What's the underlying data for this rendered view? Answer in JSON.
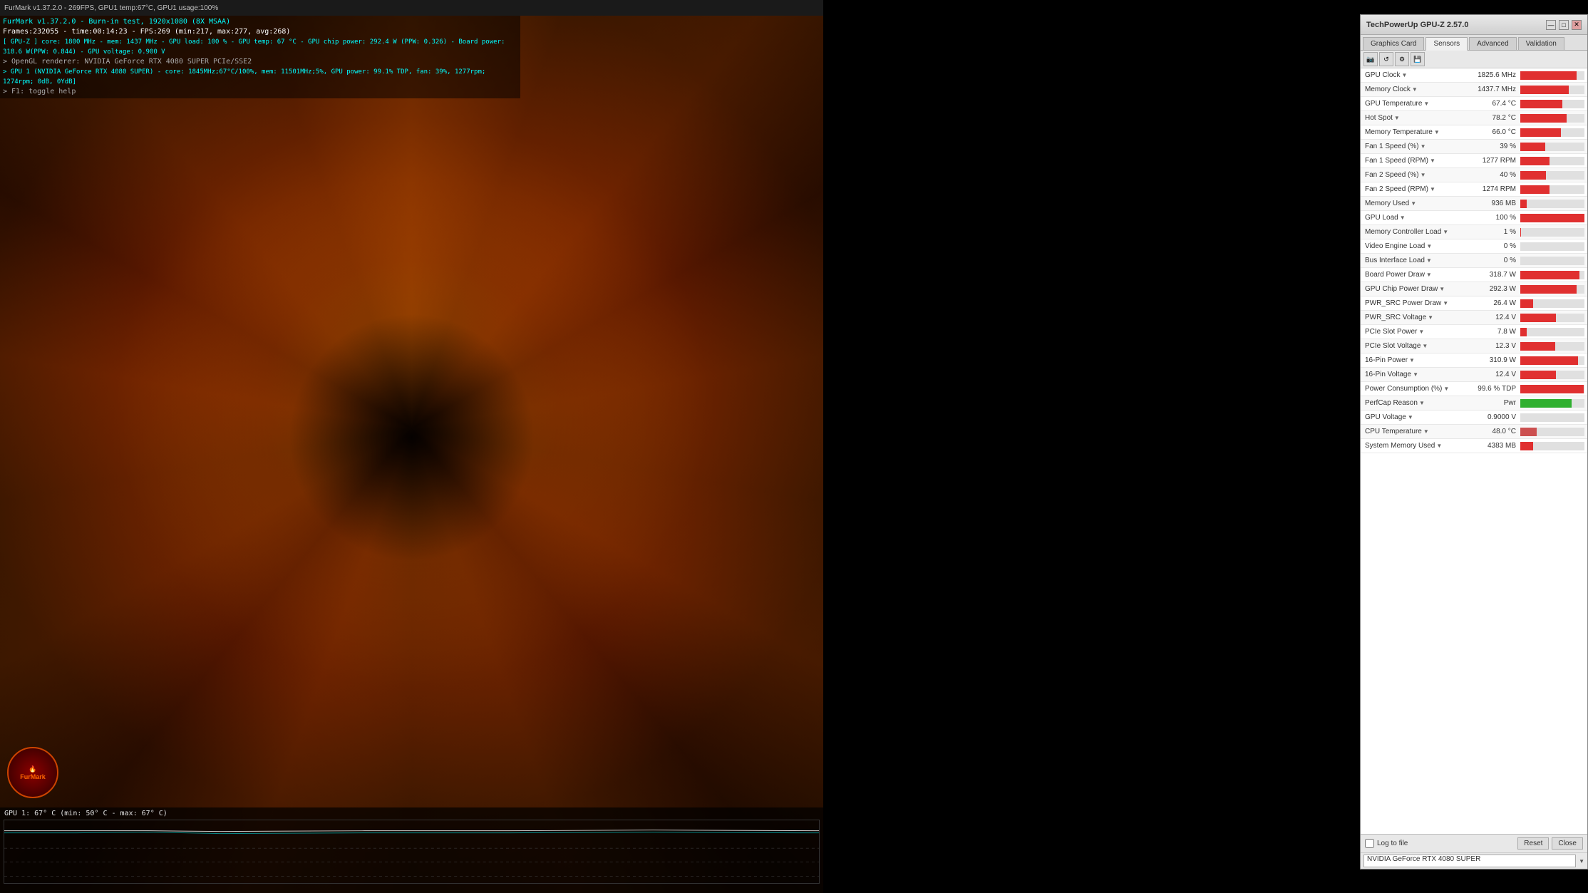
{
  "furmark": {
    "titlebar": "FurMark v1.37.2.0 - 269FPS, GPU1 temp:67°C, GPU1 usage:100%",
    "info_lines": [
      {
        "text": "FurMark v1.37.2.0 - Burn-in test, 1920x1080 (8X MSAA)",
        "color": "cyan"
      },
      {
        "text": "Frames:232055 - time:00:14:23 - FPS:269 (min:217, max:277, avg:268)",
        "color": "white"
      },
      {
        "text": "[ GPU-Z ] core: 1800 MHz - mem: 1437 MHz - GPU load: 100 % - GPU temp: 67 °C - GPU chip power: 292.4 W (PPW: 0.326) - Board power: 318.6 W(PPW: 0.844) - GPU voltage: 0.900 V",
        "color": "cyan"
      },
      {
        "text": "> OpenGL renderer: NVIDIA GeForce RTX 4080 SUPER PCIe/SSE2",
        "color": "gray"
      },
      {
        "text": "> GPU 1 (NVIDIA GeForce RTX 4080 SUPER) - core: 1845MHz;67°C/100%, mem: 11501MHz;5%, GPU power: 99.1% TDP, fan: 39%, 1277rpm; 1274rpm; 0dB, 0YdB]",
        "color": "cyan"
      },
      {
        "text": "> F1: toggle help",
        "color": "gray"
      }
    ],
    "graph_label": "GPU 1: 67° C (min: 50° C - max: 67° C)"
  },
  "gpuz": {
    "title": "TechPowerUp GPU-Z 2.57.0",
    "tabs": [
      "Graphics Card",
      "Sensors",
      "Advanced",
      "Validation"
    ],
    "active_tab": "Sensors",
    "toolbar_icons": [
      "camera",
      "refresh",
      "settings",
      "save"
    ],
    "sensors": [
      {
        "name": "GPU Clock",
        "value": "1825.6 MHz",
        "bar_pct": 88,
        "bar_color": "bar-red"
      },
      {
        "name": "Memory Clock",
        "value": "1437.7 MHz",
        "bar_pct": 75,
        "bar_color": "bar-red"
      },
      {
        "name": "GPU Temperature",
        "value": "67.4 °C",
        "bar_pct": 65,
        "bar_color": "bar-red"
      },
      {
        "name": "Hot Spot",
        "value": "78.2 °C",
        "bar_pct": 72,
        "bar_color": "bar-red"
      },
      {
        "name": "Memory Temperature",
        "value": "66.0 °C",
        "bar_pct": 63,
        "bar_color": "bar-red"
      },
      {
        "name": "Fan 1 Speed (%)",
        "value": "39 %",
        "bar_pct": 39,
        "bar_color": "bar-red"
      },
      {
        "name": "Fan 1 Speed (RPM)",
        "value": "1277 RPM",
        "bar_pct": 45,
        "bar_color": "bar-red"
      },
      {
        "name": "Fan 2 Speed (%)",
        "value": "40 %",
        "bar_pct": 40,
        "bar_color": "bar-red"
      },
      {
        "name": "Fan 2 Speed (RPM)",
        "value": "1274 RPM",
        "bar_pct": 45,
        "bar_color": "bar-red"
      },
      {
        "name": "Memory Used",
        "value": "936 MB",
        "bar_pct": 10,
        "bar_color": "bar-red"
      },
      {
        "name": "GPU Load",
        "value": "100 %",
        "bar_pct": 100,
        "bar_color": "bar-red"
      },
      {
        "name": "Memory Controller Load",
        "value": "1 %",
        "bar_pct": 1,
        "bar_color": "bar-red"
      },
      {
        "name": "Video Engine Load",
        "value": "0 %",
        "bar_pct": 0,
        "bar_color": "bar-red"
      },
      {
        "name": "Bus Interface Load",
        "value": "0 %",
        "bar_pct": 0,
        "bar_color": "bar-red"
      },
      {
        "name": "Board Power Draw",
        "value": "318.7 W",
        "bar_pct": 92,
        "bar_color": "bar-red"
      },
      {
        "name": "GPU Chip Power Draw",
        "value": "292.3 W",
        "bar_pct": 88,
        "bar_color": "bar-red"
      },
      {
        "name": "PWR_SRC Power Draw",
        "value": "26.4 W",
        "bar_pct": 20,
        "bar_color": "bar-red"
      },
      {
        "name": "PWR_SRC Voltage",
        "value": "12.4 V",
        "bar_pct": 55,
        "bar_color": "bar-red"
      },
      {
        "name": "PCIe Slot Power",
        "value": "7.8 W",
        "bar_pct": 10,
        "bar_color": "bar-red"
      },
      {
        "name": "PCIe Slot Voltage",
        "value": "12.3 V",
        "bar_pct": 54,
        "bar_color": "bar-red"
      },
      {
        "name": "16-Pin Power",
        "value": "310.9 W",
        "bar_pct": 90,
        "bar_color": "bar-red"
      },
      {
        "name": "16-Pin Voltage",
        "value": "12.4 V",
        "bar_pct": 55,
        "bar_color": "bar-red"
      },
      {
        "name": "Power Consumption (%)",
        "value": "99.6 % TDP",
        "bar_pct": 99,
        "bar_color": "bar-red"
      },
      {
        "name": "PerfCap Reason",
        "value": "Pwr",
        "bar_pct": 80,
        "bar_color": "bar-green"
      },
      {
        "name": "GPU Voltage",
        "value": "0.9000 V",
        "bar_pct": 0,
        "bar_color": "bar-red"
      },
      {
        "name": "CPU Temperature",
        "value": "48.0 °C",
        "bar_pct": 25,
        "bar_color": "bar-pink"
      },
      {
        "name": "System Memory Used",
        "value": "4383 MB",
        "bar_pct": 20,
        "bar_color": "bar-red"
      }
    ],
    "footer": {
      "log_checkbox_label": "Log to file",
      "reset_btn": "Reset",
      "close_btn": "Close"
    },
    "gpu_name": "NVIDIA GeForce RTX 4080 SUPER"
  }
}
